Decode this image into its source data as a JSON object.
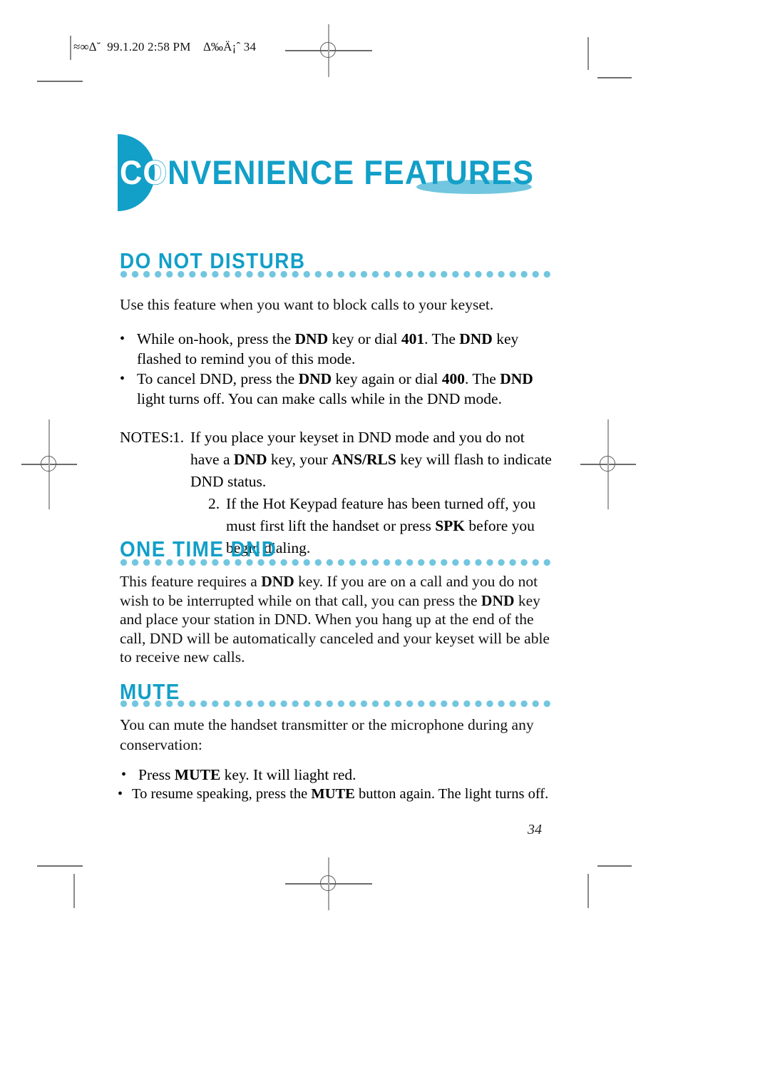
{
  "page": {
    "header_text": "≈∞∆˘  99.1.20 2:58 PM    ∆‰Ä¡ˆ 34",
    "number": "34",
    "accent_color": "#129FC8",
    "accent_light_color": "#72C6DF"
  },
  "chapter": {
    "lead": "CO",
    "rest": "NVENIENCE FEATURES",
    "full": "CONVENIENCE FEATURES"
  },
  "sections": [
    {
      "heading": "DO NOT DISTURB",
      "intro": "Use this feature when you want to block calls to your keyset.",
      "bullets": [
        {
          "parts": [
            {
              "t": "While on-hook, press the ",
              "b": false
            },
            {
              "t": "DND",
              "b": true
            },
            {
              "t": " key or dial ",
              "b": false
            },
            {
              "t": "401",
              "b": true
            },
            {
              "t": ". The ",
              "b": false
            },
            {
              "t": "DND",
              "b": true
            },
            {
              "t": " key flashed to remind you of this mode.",
              "b": false
            }
          ]
        },
        {
          "parts": [
            {
              "t": "To cancel DND, press the ",
              "b": false
            },
            {
              "t": "DND",
              "b": true
            },
            {
              "t": " key again or dial ",
              "b": false
            },
            {
              "t": "400",
              "b": true
            },
            {
              "t": ". The ",
              "b": false
            },
            {
              "t": "DND",
              "b": true
            },
            {
              "t": " light turns off. You can make calls while in the DND mode.",
              "b": false
            }
          ]
        }
      ],
      "notes_label": "NOTES:",
      "notes": [
        {
          "num": "1.",
          "parts": [
            {
              "t": "If you place your keyset in DND mode and you do not have a ",
              "b": false
            },
            {
              "t": "DND",
              "b": true
            },
            {
              "t": " key, your ",
              "b": false
            },
            {
              "t": "ANS/RLS",
              "b": true
            },
            {
              "t": " key will flash to indicate DND status.",
              "b": false
            }
          ]
        },
        {
          "num": "2.",
          "parts": [
            {
              "t": "If the Hot Keypad feature has been turned off, you must first lift the handset or press ",
              "b": false
            },
            {
              "t": "SPK",
              "b": true
            },
            {
              "t": " before you begin dialing.",
              "b": false
            }
          ]
        }
      ]
    },
    {
      "heading": "ONE TIME DND",
      "paragraph_parts": [
        {
          "t": "This feature requires a ",
          "b": false
        },
        {
          "t": "DND",
          "b": true
        },
        {
          "t": " key. If you are on a call and you do not wish to be interrupted while on that call, you can press the ",
          "b": false
        },
        {
          "t": "DND",
          "b": true
        },
        {
          "t": " key and place your station in DND. When you hang up at the end of the call, DND will be automatically canceled and your keyset will be able to receive new calls.",
          "b": false
        }
      ]
    },
    {
      "heading": "MUTE",
      "intro": "You can mute the handset transmitter or the microphone during any conservation:",
      "bullets": [
        {
          "parts": [
            {
              "t": "Press ",
              "b": false
            },
            {
              "t": "MUTE",
              "b": true
            },
            {
              "t": " key. It will liaght red.",
              "b": false
            }
          ]
        },
        {
          "parts": [
            {
              "t": "To resume speaking, press the ",
              "b": false
            },
            {
              "t": "MUTE",
              "b": true
            },
            {
              "t": " button again. The light turns off.",
              "b": false
            }
          ]
        }
      ]
    }
  ]
}
